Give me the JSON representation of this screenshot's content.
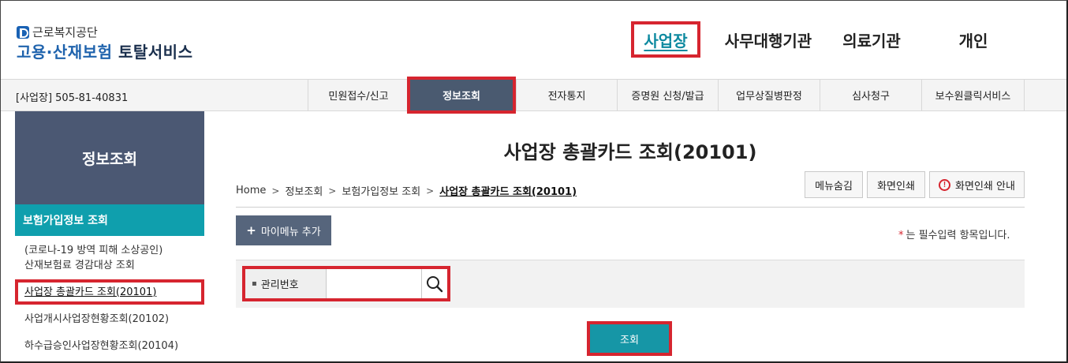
{
  "header": {
    "org_name": "근로복지공단",
    "service_title_blue": "고용·산재보험",
    "service_title_dark": "토탈서비스",
    "top_nav": [
      {
        "label": "사업장"
      },
      {
        "label": "사무대행기관"
      },
      {
        "label": "의료기관"
      },
      {
        "label": "개인"
      }
    ]
  },
  "menubar": {
    "business_id": "[사업장] 505-81-40831",
    "items": [
      {
        "label": "민원접수/신고"
      },
      {
        "label": "정보조회"
      },
      {
        "label": "전자통지"
      },
      {
        "label": "증명원 신청/발급"
      },
      {
        "label": "업무상질병판정"
      },
      {
        "label": "심사청구"
      },
      {
        "label": "보수원클릭서비스"
      }
    ]
  },
  "sidebar": {
    "title": "정보조회",
    "section": "보험가입정보 조회",
    "links": [
      {
        "label": "(코로나-19 방역 피해 소상공인)\n산재보험료 경감대상 조회"
      },
      {
        "label": "사업장 총괄카드 조회(20101)"
      },
      {
        "label": "사업개시사업장현황조회(20102)"
      },
      {
        "label": "하수급승인사업장현황조회(20104)"
      }
    ]
  },
  "main": {
    "page_title": "사업장 총괄카드 조회(20101)",
    "breadcrumb": [
      "Home",
      "정보조회",
      "보험가입정보 조회",
      "사업장 총괄카드 조회(20101)"
    ],
    "buttons": {
      "hide_menu": "메뉴숨김",
      "print": "화면인쇄",
      "print_guide": "화면인쇄 안내",
      "add_my_menu": "마이메뉴 추가",
      "query": "조회"
    },
    "required_note": "는 필수입력 항목입니다.",
    "search": {
      "label": "관리번호",
      "value": "",
      "placeholder": ""
    }
  },
  "colors": {
    "accent_teal": "#0f9fad",
    "nav_active_teal": "#0e8aa0",
    "sidebar_navy": "#4b5873",
    "highlight_red": "#d6252f"
  }
}
